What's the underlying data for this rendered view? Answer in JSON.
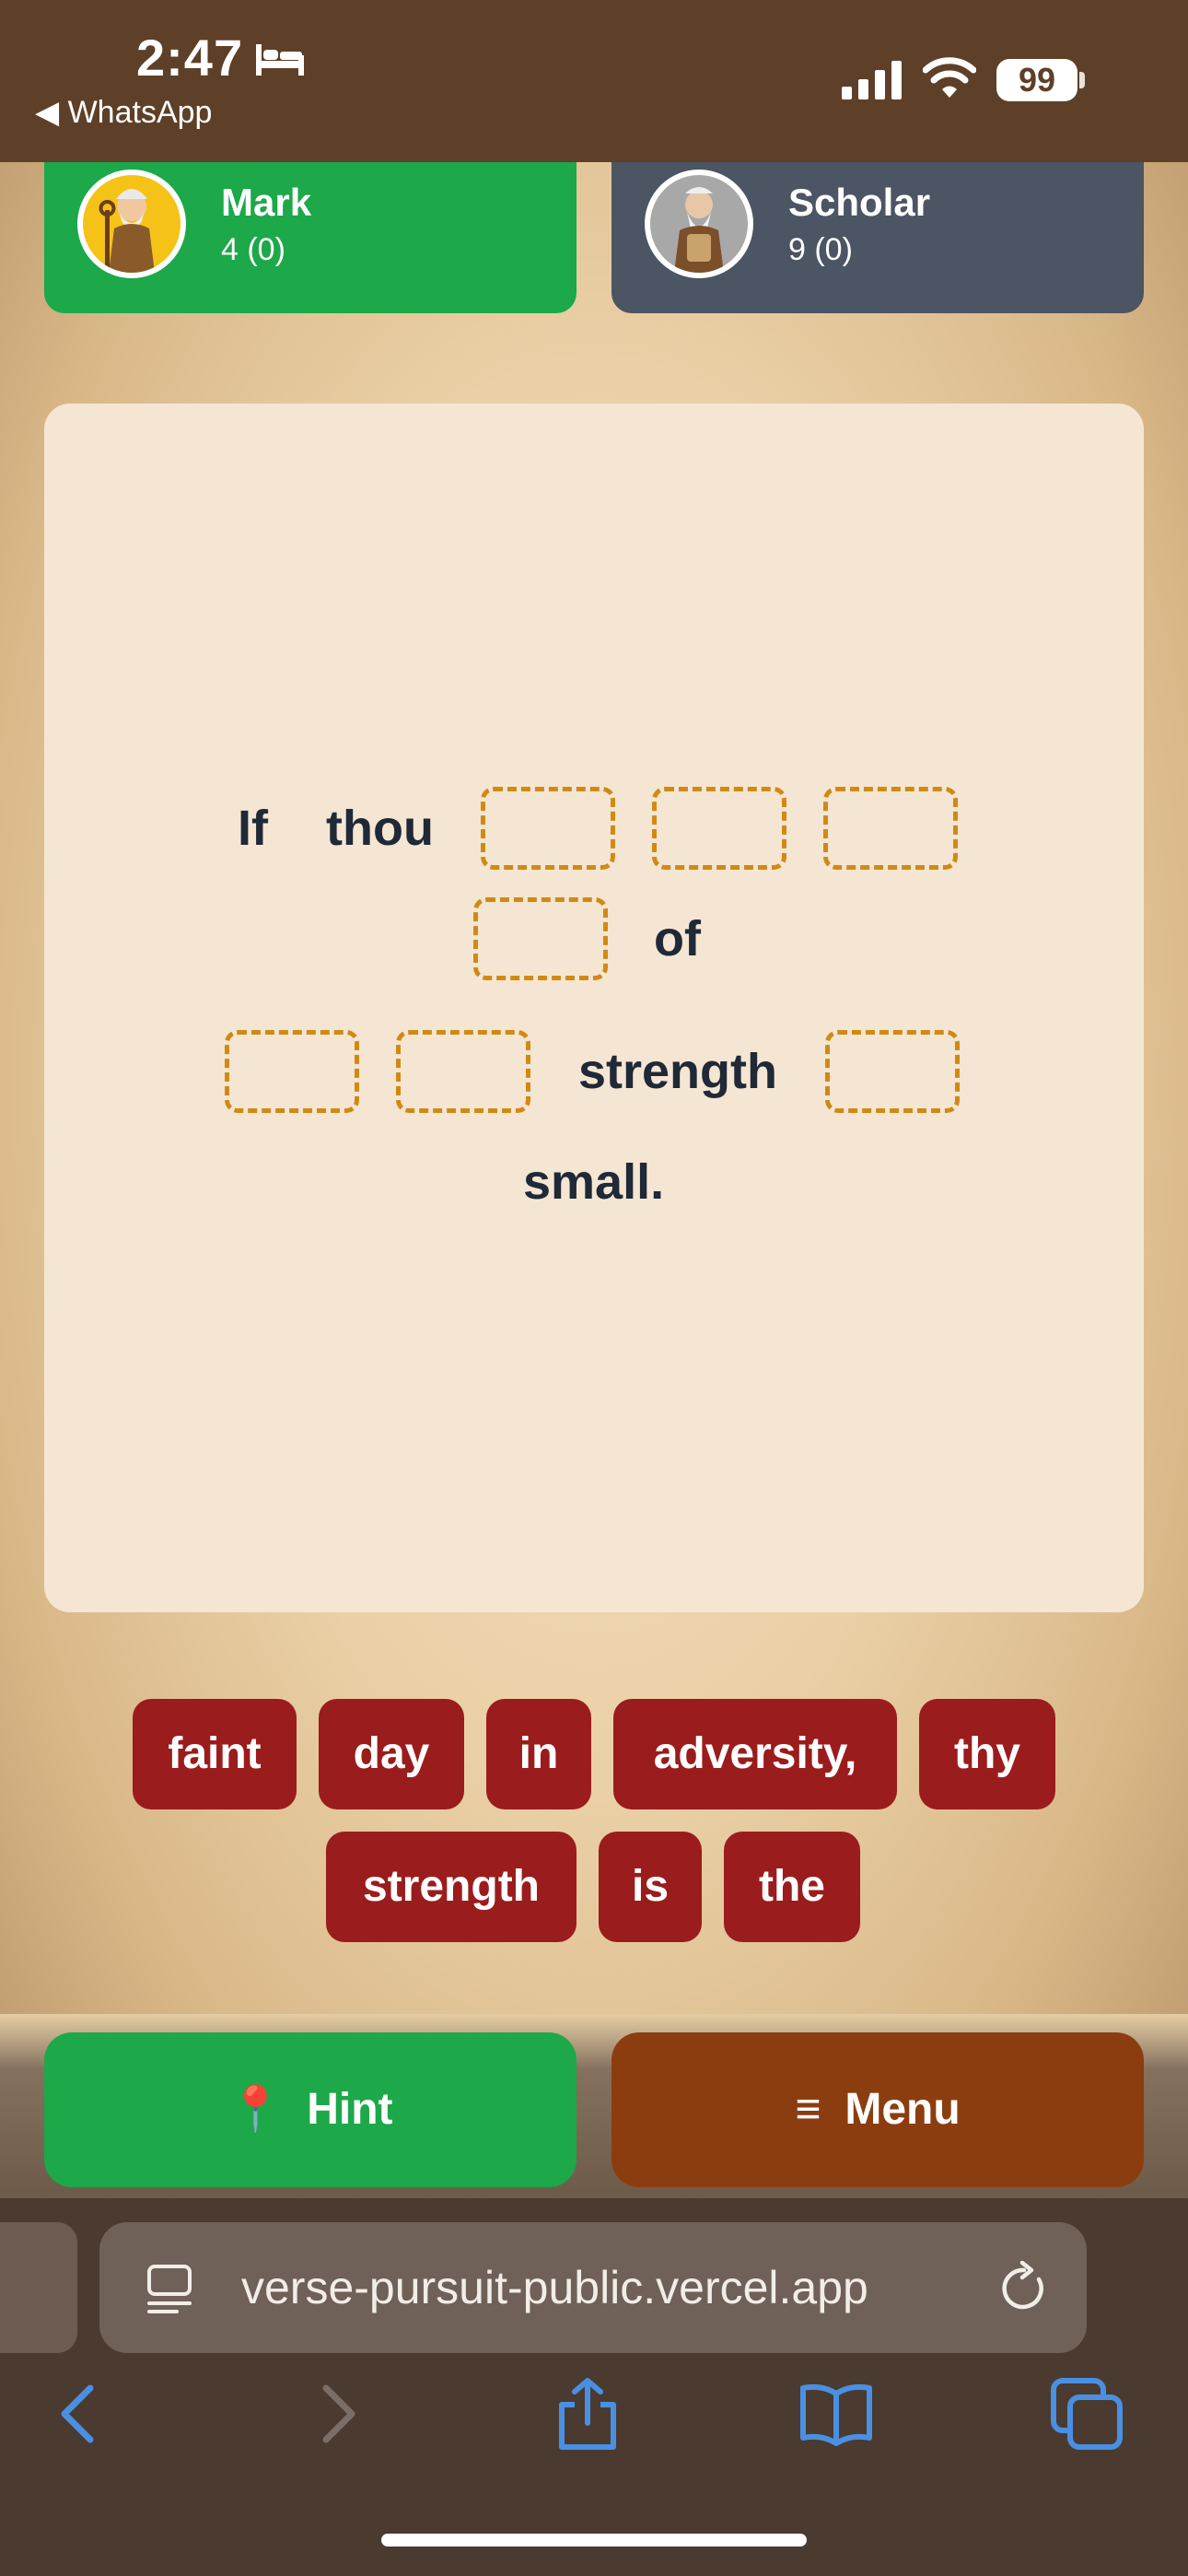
{
  "status": {
    "time": "2:47",
    "back_app": "◀ WhatsApp",
    "battery": "99"
  },
  "players": [
    {
      "name": "Mark",
      "score": "4 (0)"
    },
    {
      "name": "Scholar",
      "score": "9 (0)"
    }
  ],
  "verse": {
    "words": [
      "If",
      "thou",
      "of",
      "strength",
      "small."
    ]
  },
  "tiles": [
    "faint",
    "day",
    "in",
    "adversity,",
    "thy",
    "strength",
    "is",
    "the"
  ],
  "buttons": {
    "hint_icon": "📍",
    "hint": "Hint",
    "menu_icon": "≡",
    "menu": "Menu"
  },
  "browser": {
    "url": "verse-pursuit-public.vercel.app"
  },
  "colors": {
    "green": "#1da84a",
    "slate": "#4b5563",
    "tile_red": "#9b1c1c",
    "menu_brown": "#8c3d10",
    "slot_border": "#d08a14"
  }
}
